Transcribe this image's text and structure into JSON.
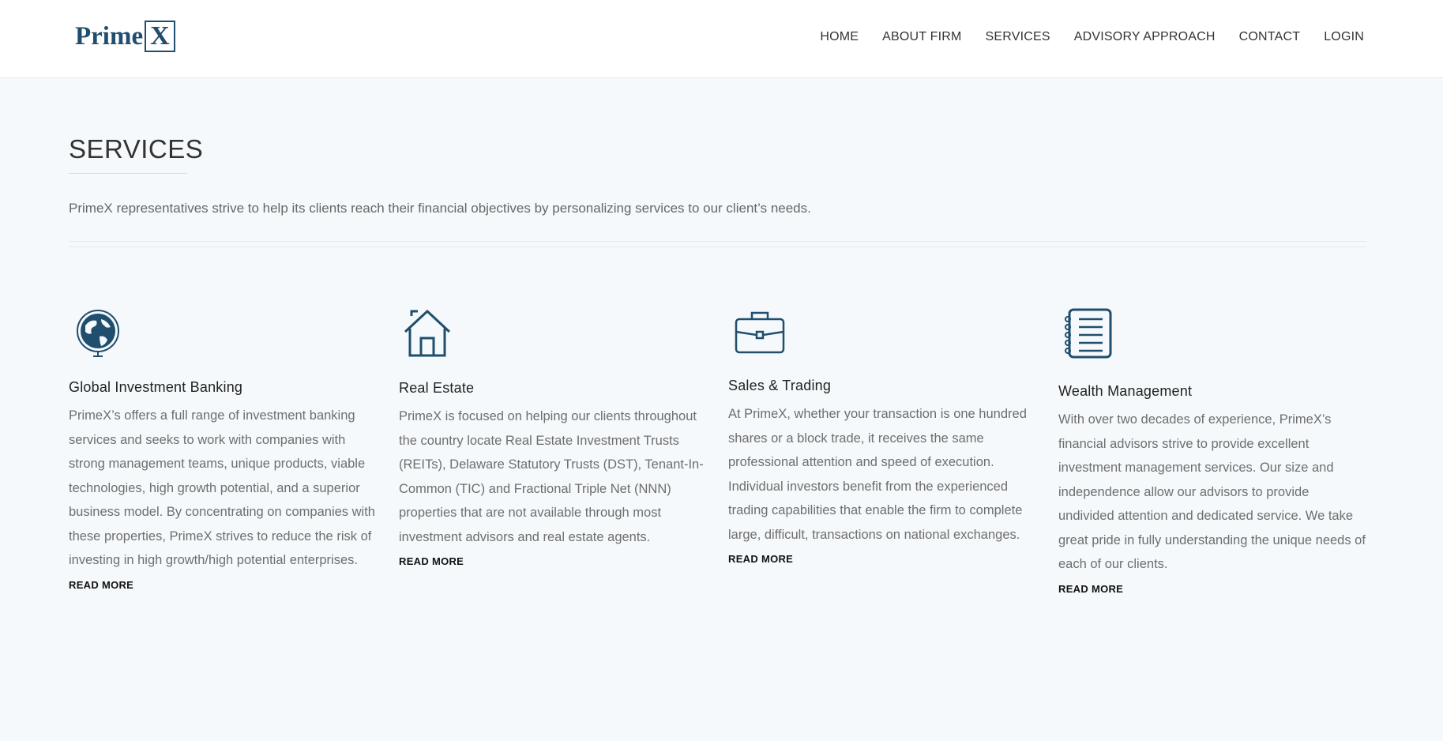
{
  "brand": {
    "logo_text": "Prime",
    "logo_box_letter": "X"
  },
  "nav": {
    "items": [
      "HOME",
      "ABOUT FIRM",
      "SERVICES",
      "ADVISORY APPROACH",
      "CONTACT",
      "LOGIN"
    ]
  },
  "page": {
    "title": "SERVICES",
    "intro": "PrimeX representatives strive to help its clients reach their financial objectives by personalizing services to our client’s needs."
  },
  "services": [
    {
      "icon": "globe-icon",
      "title": "Global Investment Banking",
      "text": "PrimeX’s offers a full range of investment banking services and seeks to work with companies with strong management teams, unique products, viable technologies, high growth potential, and a superior business model. By concentrating on companies with these properties, PrimeX strives to reduce the risk of investing in high growth/high potential enterprises.",
      "link": "READ MORE"
    },
    {
      "icon": "house-icon",
      "title": "Real Estate",
      "text": "PrimeX is focused on helping our clients throughout the country locate Real Estate Investment Trusts (REITs), Delaware Statutory Trusts (DST), Tenant-In-Common (TIC) and Fractional Triple Net (NNN) properties that are not available through most investment advisors and real estate agents.",
      "link": "READ MORE"
    },
    {
      "icon": "briefcase-icon",
      "title": "Sales & Trading",
      "text": "At PrimeX, whether your transaction is one hundred shares or a block trade, it receives the same professional attention and speed of execution. Individual investors benefit from the experienced trading capabilities that enable the firm to complete large, difficult, transactions on national exchanges.",
      "link": "READ MORE"
    },
    {
      "icon": "notebook-icon",
      "title": "Wealth Management",
      "text": "With over two decades of experience, PrimeX’s financial advisors strive to provide excellent investment management services. Our size and independence allow our advisors to provide undivided attention and dedicated service. We take great pride in fully understanding the unique needs of each of our clients.",
      "link": "READ MORE"
    }
  ],
  "colors": {
    "accent": "#1f4e6e",
    "background": "#f5f9fb",
    "header": "#ffffff"
  }
}
